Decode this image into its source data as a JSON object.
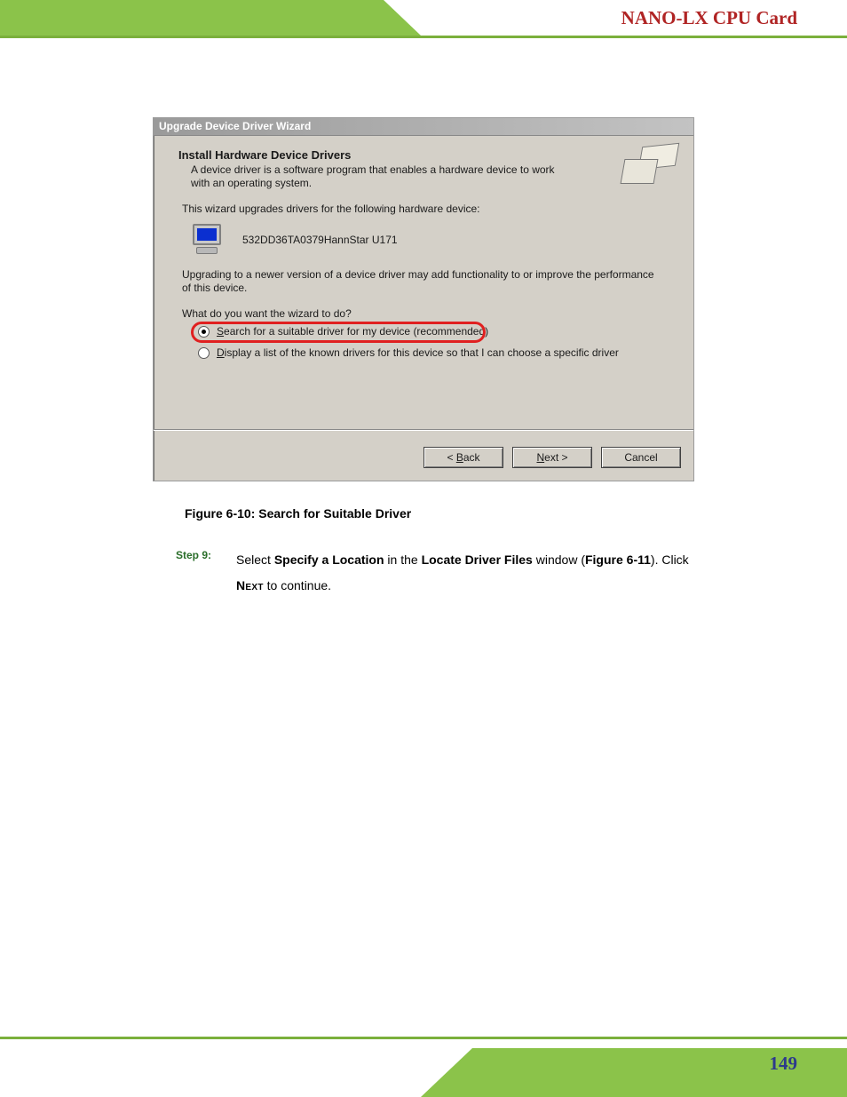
{
  "header": {
    "title": "NANO-LX CPU Card"
  },
  "footer": {
    "page": "149"
  },
  "dialog": {
    "title": "Upgrade Device Driver Wizard",
    "heading": "Install Hardware Device Drivers",
    "sub": "A device driver is a software program that enables a hardware device to work with an operating system.",
    "line1": "This wizard upgrades drivers for the following hardware device:",
    "device": "532DD36TA0379HannStar U171",
    "para": "Upgrading to a newer version of a device driver may add functionality to or improve the performance of this device.",
    "question": "What do you want the wizard to do?",
    "opt1_prefix": "S",
    "opt1_rest": "earch for a suitable driver for my device (recommended)",
    "opt2_prefix": "D",
    "opt2_rest": "isplay a list of the known drivers for this device so that I can choose a specific driver",
    "buttons": {
      "back_sym": "< ",
      "back_ul": "B",
      "back_rest": "ack",
      "next_ul": "N",
      "next_rest": "ext >",
      "cancel": "Cancel"
    }
  },
  "caption": "Figure 6-10: Search for Suitable Driver",
  "step": {
    "label": "Step 9:",
    "t1": "Select ",
    "b1": "Specify a Location",
    "t2": " in the ",
    "b2": "Locate Driver Files",
    "t3": " window (",
    "b3": "Figure 6-11",
    "t4": "). Click ",
    "sc": "Next",
    "t5": " to continue."
  }
}
